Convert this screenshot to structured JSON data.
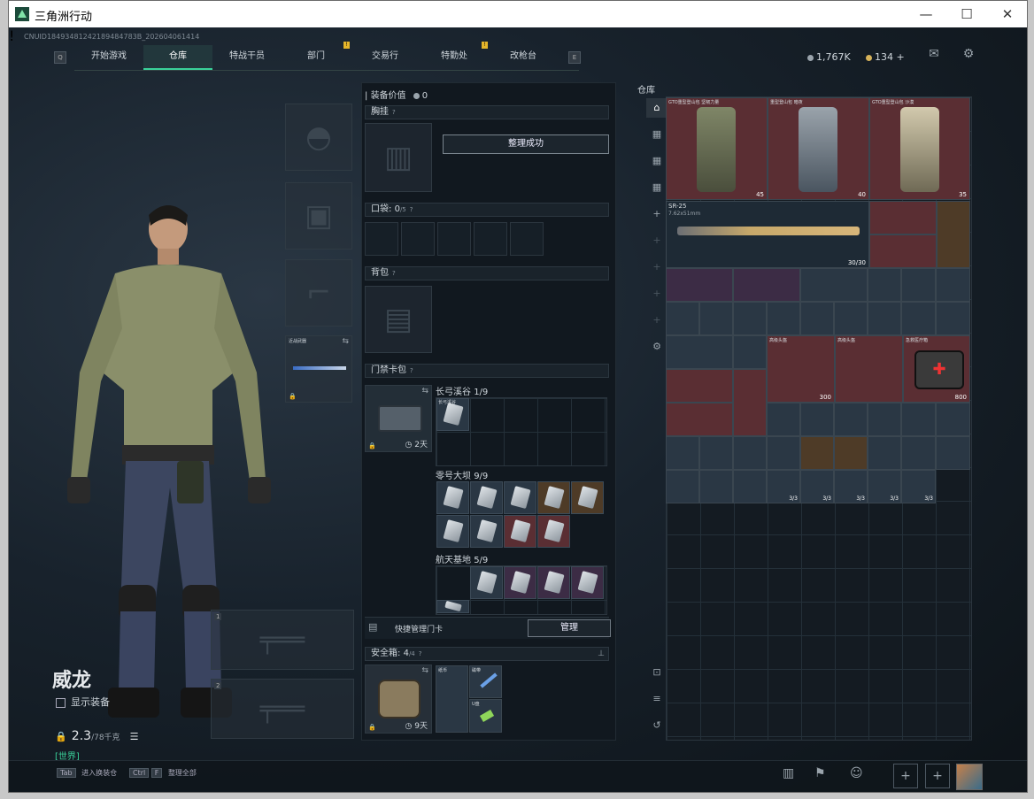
{
  "window": {
    "title": "三角洲行动",
    "controls": {
      "minimize": "—",
      "maximize": "☐",
      "close": "✕"
    }
  },
  "header": {
    "uid": "CNUID18493481242189484783B_202604061414",
    "key_left": "Q",
    "key_right": "E",
    "tabs": [
      {
        "label": "开始游戏"
      },
      {
        "label": "仓库"
      },
      {
        "label": "特战干员"
      },
      {
        "label": "部门"
      },
      {
        "label": "交易行"
      },
      {
        "label": "特勤处"
      },
      {
        "label": "改枪台"
      }
    ],
    "badge_glyph": "!",
    "currency_1": "1,767K",
    "currency_2": "134",
    "currency_plus": "+",
    "mail_badge": "!"
  },
  "colors": {
    "accent": "#3ad29a",
    "badge": "#e5b52a",
    "item_red": "#5a2e33",
    "item_gold": "#4e3b27"
  },
  "character": {
    "name": "威龙",
    "show_equip_label": "显示装备",
    "weight_value": "2.3",
    "weight_max": "/78千克",
    "bottom_label": "[世界]"
  },
  "equip": {
    "value_label": "装备价值",
    "value": "0",
    "chest_label": "胸挂",
    "toast": "整理成功",
    "pocket_label": "口袋:",
    "pocket_value": "0",
    "pocket_max": "/5",
    "backpack_label": "背包",
    "keycase_label": "门禁卡包",
    "keycase_time": "2天",
    "keys_group1": {
      "label": "长弓溪谷",
      "value": "1/9",
      "item": "长弓溪谷"
    },
    "keys_group2": {
      "label": "零号大坝",
      "value": "9/9"
    },
    "keys_group3": {
      "label": "航天基地",
      "value": "5/9"
    },
    "manage_label": "快捷管理门卡",
    "manage_button": "管理",
    "safe_label": "安全箱:",
    "safe_value": "4",
    "safe_max": "/4",
    "safe_time": "9天",
    "safe_items": [
      "纸币",
      "磁带",
      "U盘"
    ],
    "melee_label": "近战武器",
    "weapon_slot_1": "1",
    "weapon_slot_2": "2"
  },
  "warehouse": {
    "label": "仓库",
    "backpacks": [
      {
        "name": "GTO重型登山包 坚韧力量",
        "value": "45"
      },
      {
        "name": "重型登山包 暗夜",
        "value": ""
      },
      {
        "name": "GTO重型登山包 沙漠",
        "value": "40"
      },
      {
        "name": "",
        "value": "35"
      }
    ],
    "rifle_name": "SR-25",
    "rifle_cal": "7.62x51mm",
    "rifle_ammo": "30/30",
    "chest_items": [
      {
        "name": "高级头盔",
        "value": "300"
      },
      {
        "name": "高级头盔",
        "value": ""
      },
      {
        "name": "急救医疗箱",
        "value": "800"
      }
    ],
    "redpacket_count": "3/3"
  },
  "bottom": {
    "tab_key": "Tab",
    "tab_label": "进入换装仓",
    "ctrl_key": "Ctrl",
    "f_key": "F",
    "ctrl_label": "整理全部"
  }
}
